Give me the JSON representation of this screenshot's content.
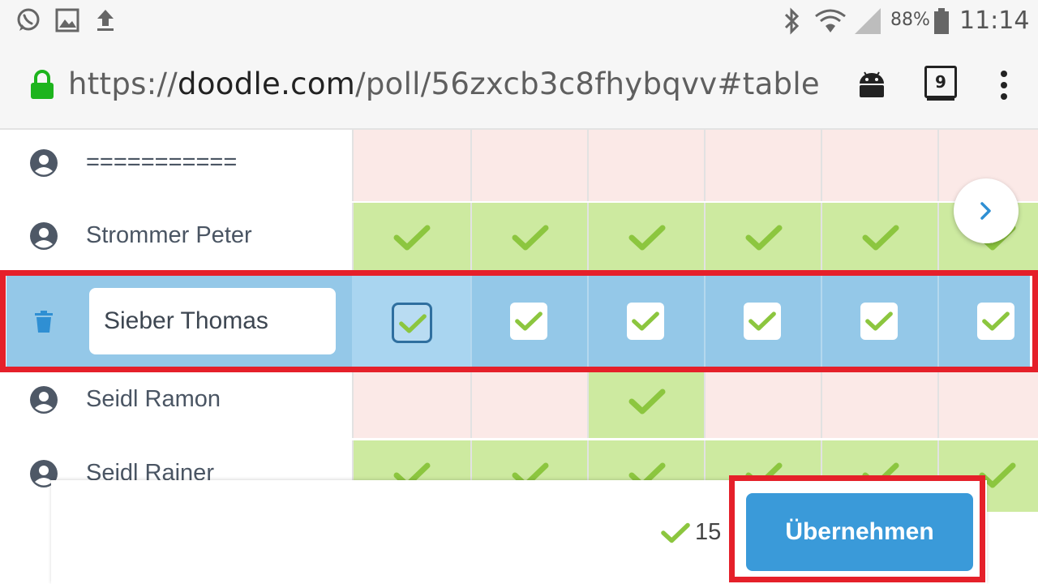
{
  "status_bar": {
    "left_icons": [
      "whatsapp-icon",
      "image-icon",
      "upload-icon"
    ],
    "right_icons": [
      "bluetooth-icon",
      "wifi-icon",
      "signal-icon",
      "battery-icon"
    ],
    "battery": "88%",
    "time": "11:14"
  },
  "browser": {
    "url_scheme": "https://",
    "url_domain": "doodle.com",
    "url_path": "/poll/56zxcb3c8fhybqvv#table",
    "tab_count": "9",
    "icons": [
      "lock-icon",
      "android-icon",
      "tabs-icon",
      "more-icon"
    ]
  },
  "poll": {
    "participants": [
      {
        "name": "===========",
        "votes": [
          "no",
          "no",
          "no",
          "no",
          "no",
          "no"
        ]
      },
      {
        "name": "Strommer Peter",
        "votes": [
          "yes",
          "yes",
          "yes",
          "yes",
          "yes",
          "yes"
        ]
      },
      {
        "name": "Sieber Thomas",
        "editing": true,
        "votes": [
          "checked",
          "checked",
          "checked",
          "checked",
          "checked",
          "checked"
        ]
      },
      {
        "name": "Seidl Ramon",
        "votes": [
          "no",
          "no",
          "yes",
          "no",
          "no",
          "no"
        ]
      },
      {
        "name": "Seidl Rainer",
        "votes": [
          "yes",
          "yes",
          "yes",
          "yes",
          "yes",
          "yes"
        ]
      }
    ]
  },
  "footer": {
    "yes_count": "15",
    "apply_label": "Übernehmen"
  },
  "colors": {
    "yes_cell": "#cdeaa0",
    "no_cell": "#fbe9e7",
    "selected_row": "#94c8e8",
    "check_green": "#8cc63f",
    "primary_button": "#3a9ad9",
    "highlight_outline": "#e5202a"
  }
}
